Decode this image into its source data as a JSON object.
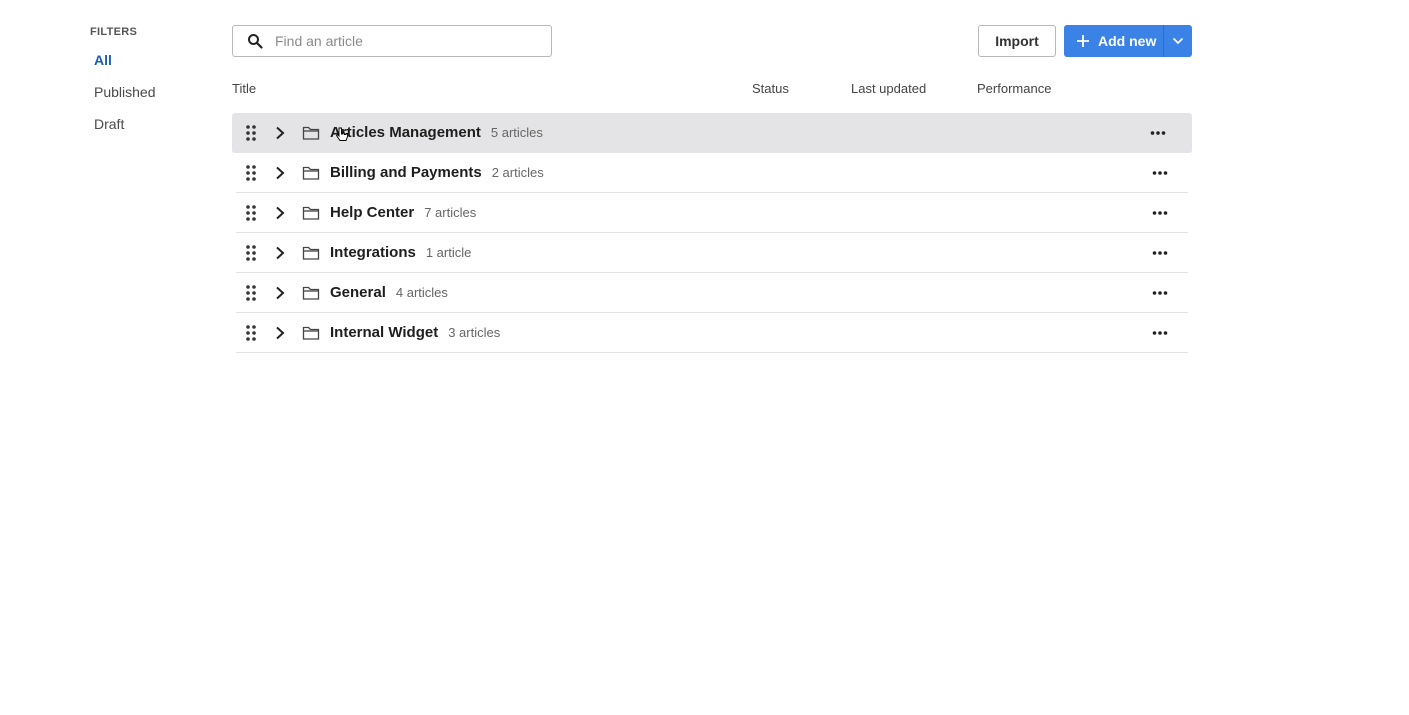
{
  "sidebar": {
    "heading": "FILTERS",
    "items": [
      {
        "label": "All",
        "active": true
      },
      {
        "label": "Published",
        "active": false
      },
      {
        "label": "Draft",
        "active": false
      }
    ]
  },
  "toolbar": {
    "search_placeholder": "Find an article",
    "search_value": "",
    "import_label": "Import",
    "add_label": "Add new",
    "accent_color": "#3b82e6"
  },
  "columns": {
    "title": "Title",
    "status": "Status",
    "last_updated": "Last updated",
    "performance": "Performance"
  },
  "rows": [
    {
      "title": "Articles Management",
      "count": "5 articles",
      "hovered": true
    },
    {
      "title": "Billing and Payments",
      "count": "2 articles",
      "hovered": false
    },
    {
      "title": "Help Center",
      "count": "7 articles",
      "hovered": false
    },
    {
      "title": "Integrations",
      "count": "1 article",
      "hovered": false
    },
    {
      "title": "General",
      "count": "4 articles",
      "hovered": false
    },
    {
      "title": "Internal Widget",
      "count": "3 articles",
      "hovered": false
    }
  ]
}
